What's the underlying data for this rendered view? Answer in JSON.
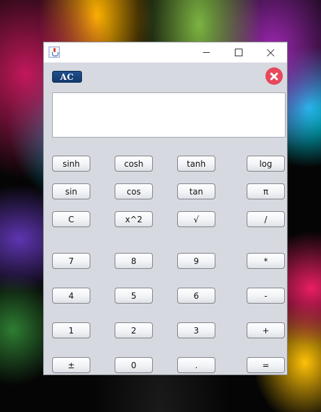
{
  "window": {
    "title": "",
    "icon": "java-cup-icon",
    "controls": {
      "minimize": "minimize-icon",
      "maximize": "maximize-icon",
      "close": "close-icon"
    }
  },
  "toolbar": {
    "ac_label": "AC",
    "exit_icon": "red-circle-x-icon",
    "exit_color": "#e8485b"
  },
  "display": {
    "value": ""
  },
  "keypad": {
    "rows": [
      [
        "sinh",
        "cosh",
        "tanh",
        "log"
      ],
      [
        "sin",
        "cos",
        "tan",
        "π"
      ],
      [
        "C",
        "x^2",
        "√",
        "/"
      ],
      [
        "7",
        "8",
        "9",
        "*"
      ],
      [
        "4",
        "5",
        "6",
        "-"
      ],
      [
        "1",
        "2",
        "3",
        "+"
      ],
      [
        "±",
        "0",
        ".",
        "="
      ]
    ]
  },
  "colors": {
    "accent": "#113a6e",
    "window_bg": "#d6d9df"
  }
}
